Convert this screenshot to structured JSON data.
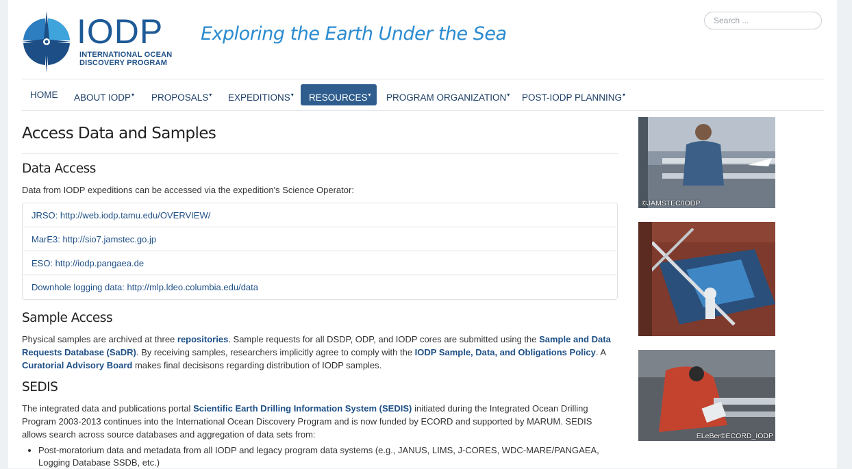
{
  "logo": {
    "title": "IODP",
    "subtitle_line1": "INTERNATIONAL OCEAN",
    "subtitle_line2": "DISCOVERY PROGRAM"
  },
  "tagline": "Exploring the Earth Under the Sea",
  "search": {
    "placeholder": "Search ..."
  },
  "nav": {
    "items": [
      {
        "label": "HOME",
        "dropdown": false
      },
      {
        "label": "ABOUT IODP",
        "dropdown": true
      },
      {
        "label": "PROPOSALS",
        "dropdown": true
      },
      {
        "label": "EXPEDITIONS",
        "dropdown": true
      },
      {
        "label": "RESOURCES",
        "dropdown": true,
        "active": true
      },
      {
        "label": "PROGRAM ORGANIZATION",
        "dropdown": true
      },
      {
        "label": "POST-IODP PLANNING",
        "dropdown": true
      }
    ],
    "caret": "▾"
  },
  "main": {
    "title": "Access Data and Samples",
    "data_access": {
      "heading": "Data Access",
      "intro": "Data from IODP expeditions can be accessed via the expedition's Science Operator:",
      "links": [
        "JRSO: http://web.iodp.tamu.edu/OVERVIEW/",
        "MarE3: http://sio7.jamstec.go.jp",
        "ESO: http://iodp.pangaea.de",
        "Downhole logging data: http://mlp.ldeo.columbia.edu/data"
      ]
    },
    "sample_access": {
      "heading": "Sample Access",
      "t1": "Physical samples are archived at three ",
      "l1": "repositories",
      "t2": ". Sample requests for all DSDP, ODP, and IODP cores are submitted using the ",
      "l2": "Sample and Data Requests Database (SaDR)",
      "t3": ". By receiving samples, researchers implicitly agree to comply with the ",
      "l3": "IODP Sample, Data, and Obligations Policy",
      "t4": ". A ",
      "l4": "Curatorial Advisory Board",
      "t5": " makes final decisisons regarding distribution of IODP samples."
    },
    "sedis": {
      "heading": "SEDIS",
      "t1": "The integrated data and publications portal ",
      "l1": "Scientific Earth Drilling Information System (SEDIS)",
      "t2": " initiated during the Integrated Ocean Drilling Program 2003-2013 continues into the International Ocean Discovery Program and is now funded by ECORD and supported by MARUM. SEDIS allows search across source databases and aggregation of data sets from:",
      "bullets": [
        "Post-moratorium data and metadata from all IODP and legacy program data systems (e.g., JANUS, LIMS, J-CORES, WDC-MARE/PANGAEA, Logging Database SSDB, etc.)"
      ]
    }
  },
  "sidebar": {
    "images": [
      {
        "caption": "©JAMSTEC/IODP"
      },
      {
        "caption": ""
      },
      {
        "caption": "ELeBer©ECORD_IODP"
      }
    ]
  },
  "colors": {
    "brand_blue": "#1d5a97",
    "tagline_blue": "#2a8bd0",
    "nav_active": "#2f5e8e",
    "link": "#1d4f86"
  }
}
